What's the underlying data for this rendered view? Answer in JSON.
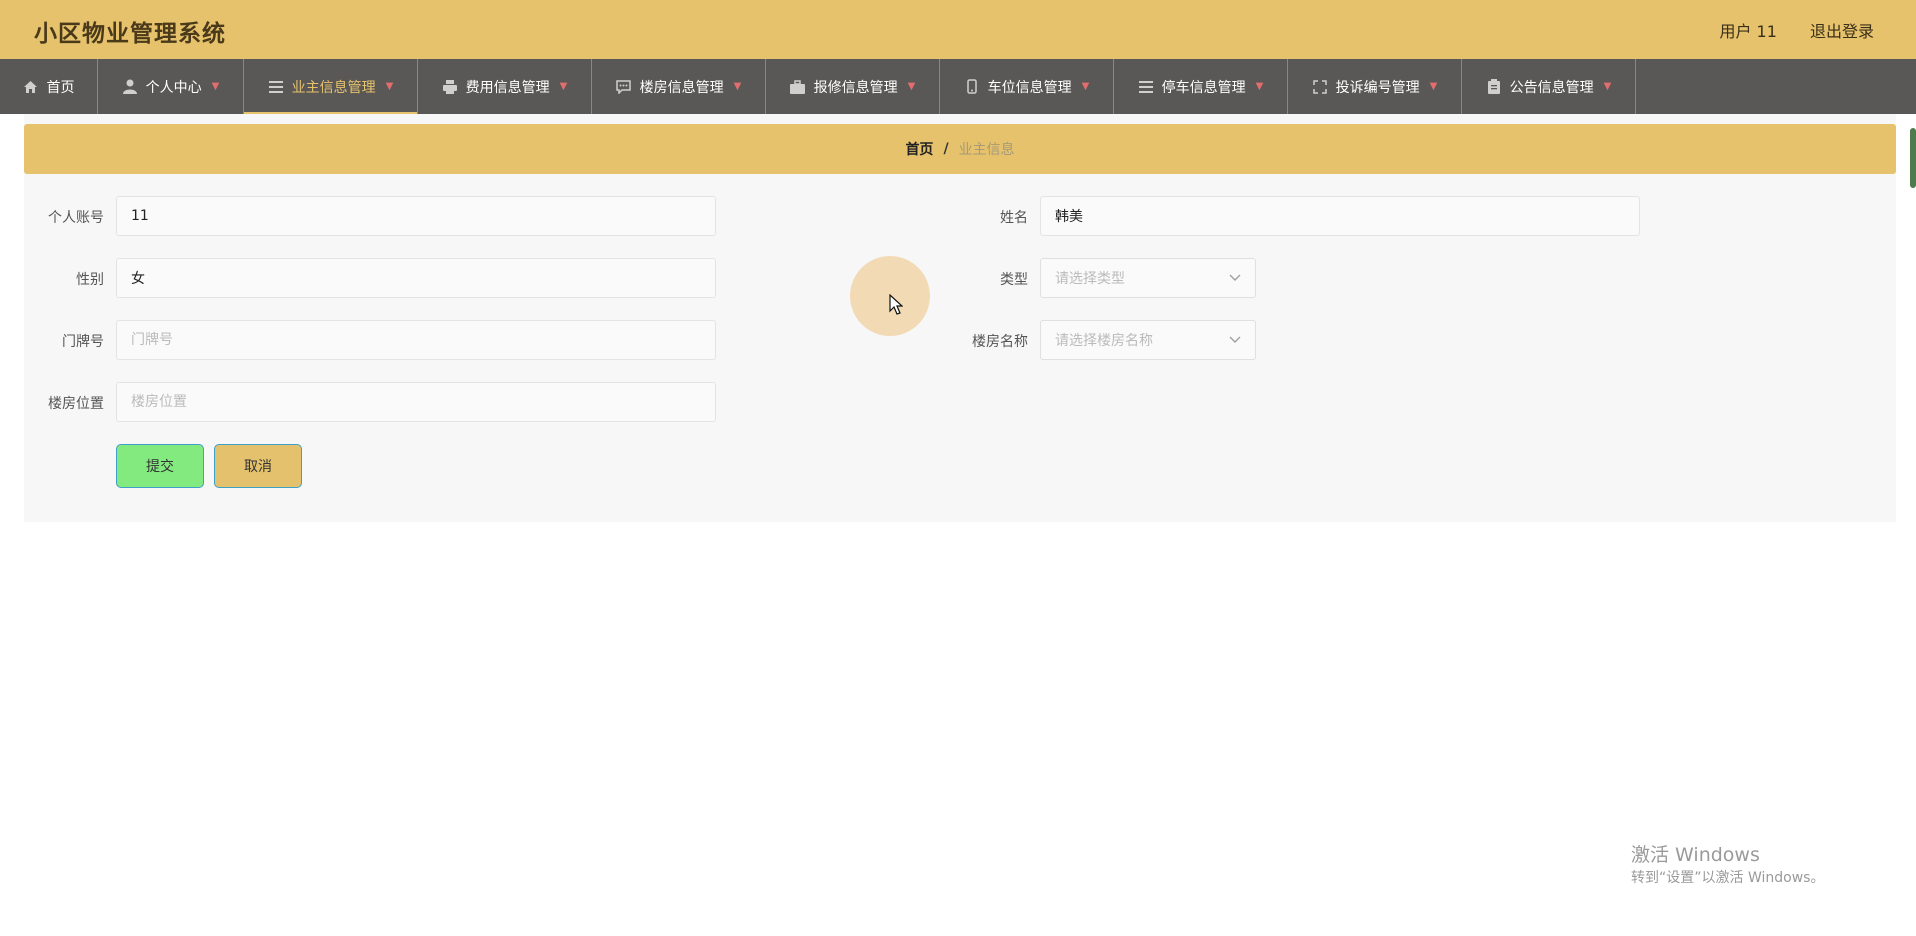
{
  "header": {
    "title": "小区物业管理系统",
    "user_label": "用户 11",
    "logout_label": "退出登录"
  },
  "nav": {
    "items": [
      {
        "label": "首页",
        "icon": "home-icon"
      },
      {
        "label": "个人中心",
        "icon": "user-icon"
      },
      {
        "label": "业主信息管理",
        "icon": "list-icon",
        "active": true
      },
      {
        "label": "费用信息管理",
        "icon": "printer-icon"
      },
      {
        "label": "楼房信息管理",
        "icon": "chat-icon"
      },
      {
        "label": "报修信息管理",
        "icon": "briefcase-icon"
      },
      {
        "label": "车位信息管理",
        "icon": "mobile-icon"
      },
      {
        "label": "停车信息管理",
        "icon": "menu-icon"
      },
      {
        "label": "投诉编号管理",
        "icon": "fullscreen-icon"
      },
      {
        "label": "公告信息管理",
        "icon": "clipboard-icon"
      }
    ]
  },
  "breadcrumb": {
    "home": "首页",
    "separator": "/",
    "current": "业主信息"
  },
  "form": {
    "account": {
      "label": "个人账号",
      "value": "11"
    },
    "name": {
      "label": "姓名",
      "value": "韩美"
    },
    "gender": {
      "label": "性别",
      "value": "女"
    },
    "type": {
      "label": "类型",
      "placeholder": "请选择类型"
    },
    "door_number": {
      "label": "门牌号",
      "value": "",
      "placeholder": "门牌号"
    },
    "building_name": {
      "label": "楼房名称",
      "placeholder": "请选择楼房名称"
    },
    "building_location": {
      "label": "楼房位置",
      "value": "",
      "placeholder": "楼房位置"
    },
    "submit_label": "提交",
    "cancel_label": "取消"
  },
  "watermark": {
    "line1": "激活 Windows",
    "line2": "转到“设置”以激活 Windows。"
  },
  "colors": {
    "accent": "#e6c26c",
    "nav_bg": "#5a5856",
    "submit_bg": "#83ea7f",
    "cancel_bg": "#e3c16d",
    "chevron": "#e06e6e"
  }
}
